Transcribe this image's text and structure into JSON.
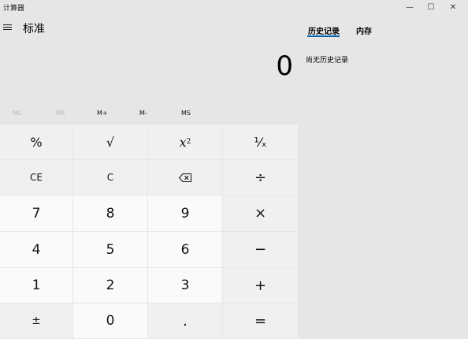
{
  "window": {
    "title": "计算器",
    "min_icon": "—",
    "max_icon": "☐",
    "close_icon": "✕"
  },
  "header": {
    "mode": "标准"
  },
  "display": {
    "value": "0"
  },
  "memory": [
    "MC",
    "MR",
    "M+",
    "M-",
    "MS"
  ],
  "keys": {
    "percent": "%",
    "sqrt": "√",
    "x2_base": "x",
    "x2_exp": "2",
    "reciprocal": "¹⁄ₓ",
    "ce": "CE",
    "c": "C",
    "divide": "÷",
    "n7": "7",
    "n8": "8",
    "n9": "9",
    "multiply": "×",
    "n4": "4",
    "n5": "5",
    "n6": "6",
    "minus": "−",
    "n1": "1",
    "n2": "2",
    "n3": "3",
    "plus": "+",
    "negate": "±",
    "n0": "0",
    "decimal": ".",
    "equals": "="
  },
  "history": {
    "tab_history": "历史记录",
    "tab_memory": "内存",
    "empty_text": "尚无历史记录"
  }
}
